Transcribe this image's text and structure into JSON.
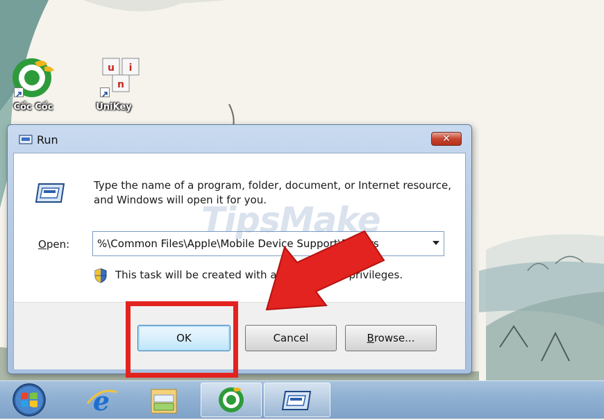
{
  "desktop": {
    "icons": [
      {
        "label": "Cốc Cốc",
        "icon": "coccoc-icon"
      },
      {
        "label": "UniKey",
        "icon": "unikey-icon"
      }
    ]
  },
  "watermark": {
    "text": "TipsMake"
  },
  "run_dialog": {
    "title": "Run",
    "close_label": "✕",
    "description": "Type the name of a program, folder, document, or Internet resource, and Windows will open it for you.",
    "open_label": "Open:",
    "open_value": "%\\Common Files\\Apple\\Mobile Device Support\\Drivers",
    "admin_note": "This task will be created with administrative privileges.",
    "buttons": {
      "ok": "OK",
      "cancel": "Cancel",
      "browse": "Browse..."
    }
  },
  "annotation": {
    "highlight_color": "#e2231f",
    "arrow_color": "#e2231f"
  },
  "taskbar": {
    "items": [
      {
        "icon": "start-orb-icon"
      },
      {
        "icon": "internet-explorer-icon"
      },
      {
        "icon": "file-explorer-icon"
      },
      {
        "icon": "coccoc-icon",
        "active": true
      },
      {
        "icon": "run-window-icon",
        "active": true
      }
    ]
  }
}
